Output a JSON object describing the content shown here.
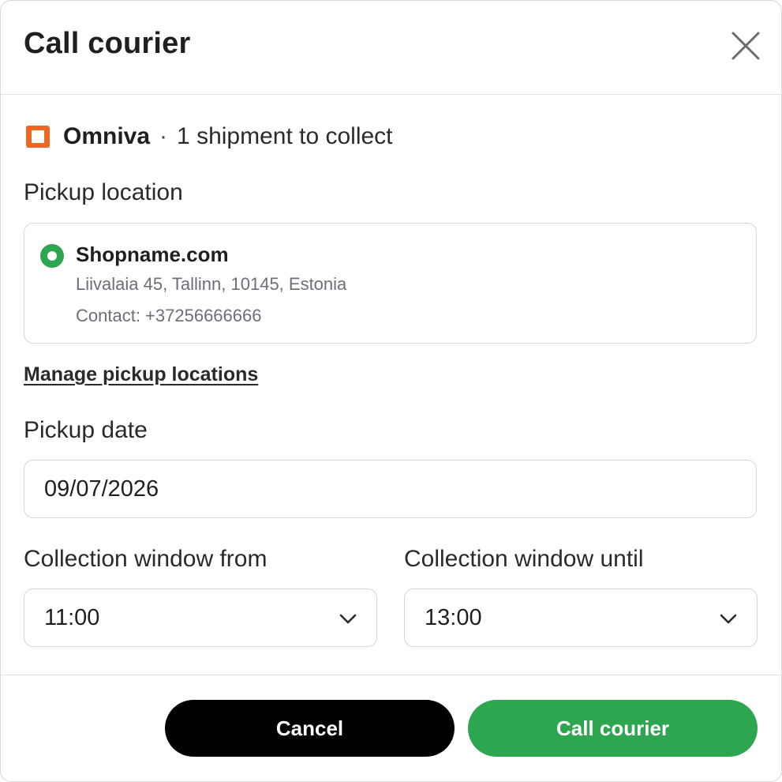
{
  "dialog": {
    "title": "Call courier",
    "close_icon": "close-icon"
  },
  "carrier": {
    "logo_icon": "omniva-logo-icon",
    "name": "Omniva",
    "separator": "·",
    "summary": "1 shipment to collect",
    "brand_color": "#f26522"
  },
  "pickup_location": {
    "label": "Pickup location",
    "selected": true,
    "name": "Shopname.com",
    "address": "Liivalaia 45, Tallinn, 10145, Estonia",
    "contact": "Contact: +37256666666",
    "manage_link": "Manage pickup locations"
  },
  "pickup_date": {
    "label": "Pickup date",
    "value": "09/07/2026"
  },
  "collection_window": {
    "from_label": "Collection window from",
    "from_value": "11:00",
    "until_label": "Collection window until",
    "until_value": "13:00",
    "chevron_icon": "chevron-down-icon"
  },
  "actions": {
    "cancel_label": "Cancel",
    "submit_label": "Call courier"
  },
  "colors": {
    "primary_green": "#2ea64f",
    "cancel_black": "#000000",
    "muted_text": "#6a6f78",
    "border": "#d6d6d6"
  }
}
